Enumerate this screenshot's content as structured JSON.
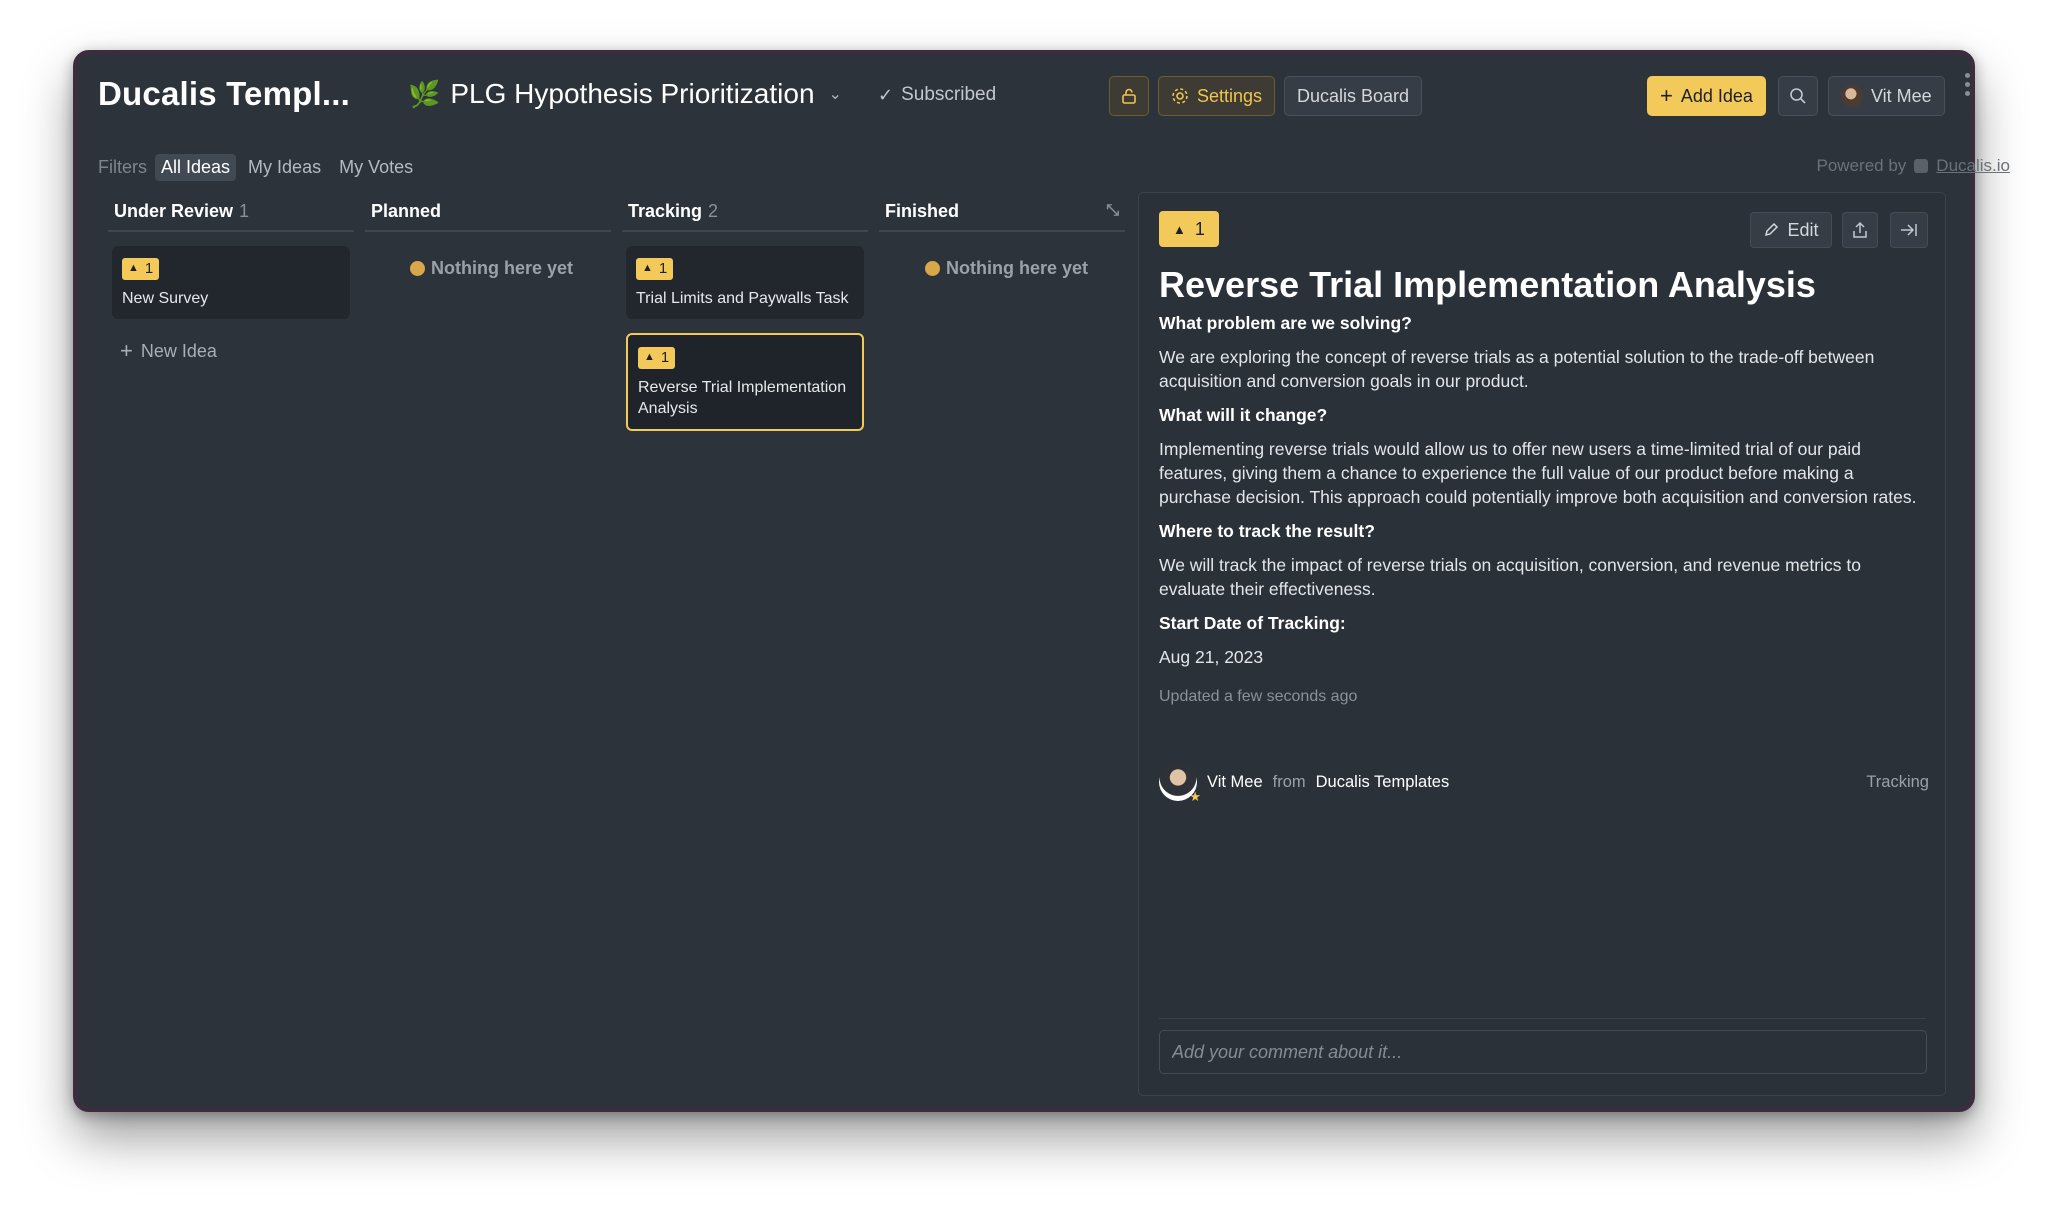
{
  "header": {
    "app_title": "Ducalis Templ...",
    "board_emoji": "🌿",
    "board_name": "PLG Hypothesis Prioritization",
    "subscribed_label": "Subscribed",
    "settings_label": "Settings",
    "board_link_label": "Ducalis Board",
    "add_idea_label": "Add Idea",
    "user_name": "Vit Mee"
  },
  "filters": {
    "label": "Filters",
    "items": [
      "All Ideas",
      "My Ideas",
      "My Votes"
    ],
    "active": "All Ideas"
  },
  "powered": {
    "text": "Powered by",
    "link": "Ducalis.io"
  },
  "columns": [
    {
      "name": "Under Review",
      "count": "1",
      "cards": [
        {
          "votes": "1",
          "title": "New Survey"
        }
      ],
      "new_idea_label": "New Idea"
    },
    {
      "name": "Planned",
      "count": "",
      "empty_text": "Nothing here yet"
    },
    {
      "name": "Tracking",
      "count": "2",
      "cards": [
        {
          "votes": "1",
          "title": "Trial Limits and Paywalls Task"
        },
        {
          "votes": "1",
          "title": "Reverse Trial Implementation Analysis",
          "selected": true
        }
      ]
    },
    {
      "name": "Finished",
      "count": "",
      "empty_text": "Nothing here yet"
    }
  ],
  "detail": {
    "votes": "1",
    "edit_label": "Edit",
    "title": "Reverse Trial Implementation Analysis",
    "sections": [
      {
        "heading": "What problem are we solving?",
        "body": "We are exploring the concept of reverse trials as a potential solution to the trade-off between acquisition and conversion goals in our product."
      },
      {
        "heading": "What will it change?",
        "body": "Implementing reverse trials would allow us to offer new users a time-limited trial of our paid features, giving them a chance to experience the full value of our product before making a purchase decision. This approach could potentially improve both acquisition and conversion rates."
      },
      {
        "heading": "Where to track the result?",
        "body": "We will track the impact of reverse trials on acquisition, conversion, and revenue metrics to evaluate their effectiveness."
      },
      {
        "heading": "Start Date of Tracking:",
        "body": "Aug 21, 2023"
      }
    ],
    "updated": "Updated a few seconds ago",
    "author": {
      "name": "Vit Mee",
      "from_label": "from",
      "workspace": "Ducalis Templates"
    },
    "status": "Tracking",
    "comment_placeholder": "Add your comment about it..."
  },
  "colors": {
    "accent": "#f3c95a",
    "background": "#2d333b",
    "card": "#22272e"
  }
}
